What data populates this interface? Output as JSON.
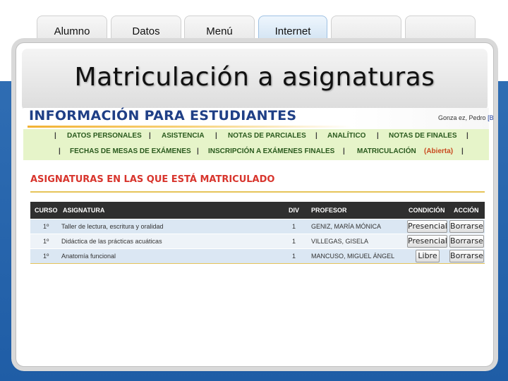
{
  "tabs": [
    {
      "label": "Alumno"
    },
    {
      "label": "Datos"
    },
    {
      "label": "Menú"
    },
    {
      "label": "Internet"
    },
    {
      "label": ""
    },
    {
      "label": ""
    }
  ],
  "slide": {
    "title": "Matriculación a asignaturas"
  },
  "site": {
    "title": "INFORMACIÓN PARA ESTUDIANTES",
    "user_name": "Gonza ez, Pedro",
    "user_link": "[BA"
  },
  "nav": {
    "row1": [
      "DATOS PERSONALES",
      "ASISTENCIA",
      "NOTAS DE PARCIALES",
      "ANALÍTICO",
      "NOTAS DE FINALES"
    ],
    "row2": [
      "FECHAS DE MESAS DE EXÁMENES",
      "INSCRIPCIÓN A EXÁMENES FINALES",
      "MATRICULACIÓN"
    ],
    "matriculacion_status": "(Abierta)",
    "separator": "|"
  },
  "section": {
    "title": "ASIGNATURAS EN LAS QUE ESTÁ MATRICULADO"
  },
  "table": {
    "headers": {
      "curso": "CURSO",
      "asignatura": "ASIGNATURA",
      "div": "DIV",
      "profesor": "PROFESOR",
      "condicion": "CONDICIÓN",
      "accion": "ACCIÓN"
    },
    "rows": [
      {
        "curso": "1º",
        "asignatura": "Taller de lectura, escritura y oralidad",
        "div": "1",
        "profesor": "GENIZ, MARÍA MÓNICA",
        "condicion": "Presencial",
        "accion": "Borrarse"
      },
      {
        "curso": "1º",
        "asignatura": "Didáctica de las prácticas acuáticas",
        "div": "1",
        "profesor": "VILLEGAS, GISELA",
        "condicion": "Presencial",
        "accion": "Borrarse"
      },
      {
        "curso": "1º",
        "asignatura": "Anatomía funcional",
        "div": "1",
        "profesor": "MANCUSO, MIGUEL ÁNGEL",
        "condicion": "Libre",
        "accion": "Borrarse"
      }
    ]
  },
  "colors": {
    "site_title": "#1f3f86",
    "section_title": "#d8352d",
    "nav_bg": "#e6f4c9",
    "nav_text": "#2a5a1e",
    "table_header": "#2f2f2f",
    "background_blue": "#2f6db3"
  }
}
